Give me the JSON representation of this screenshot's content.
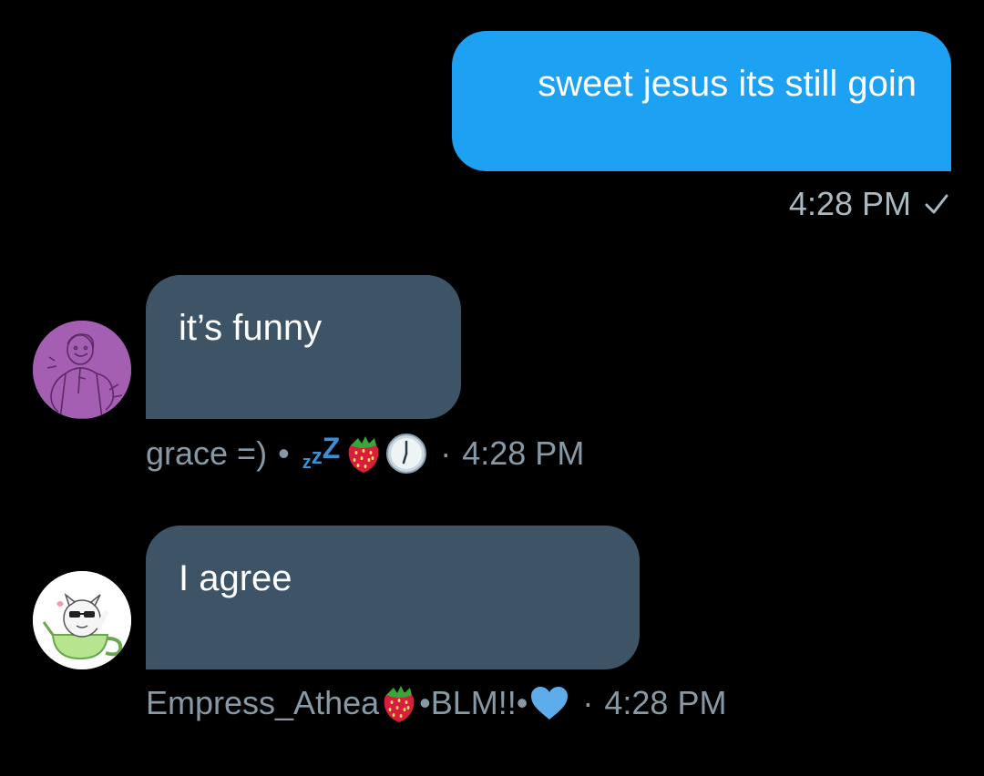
{
  "outgoing": {
    "text": "sweet jesus its still goin",
    "time": "4:28 PM",
    "status_icon": "check-icon",
    "bubble_color": "#1da1f2"
  },
  "incoming": [
    {
      "text": "it’s funny",
      "sender": "grace =)",
      "sender_sep": "•",
      "sender_emojis": [
        "zzz-icon",
        "strawberry-icon",
        "clock-icon"
      ],
      "time_sep": "·",
      "time": "4:28 PM",
      "avatar_icon": "drawn-character-avatar"
    },
    {
      "text": "I agree",
      "sender": "Empress_Athea",
      "sender_suffix": "•BLM!!•",
      "sender_emojis": [
        "strawberry-icon",
        "blue-heart-icon"
      ],
      "time_sep": "·",
      "time": "4:28 PM",
      "avatar_icon": "teacup-creature-avatar"
    }
  ],
  "colors": {
    "background": "#000000",
    "incoming_bubble": "#3d5466",
    "meta_text": "#8899a6"
  }
}
